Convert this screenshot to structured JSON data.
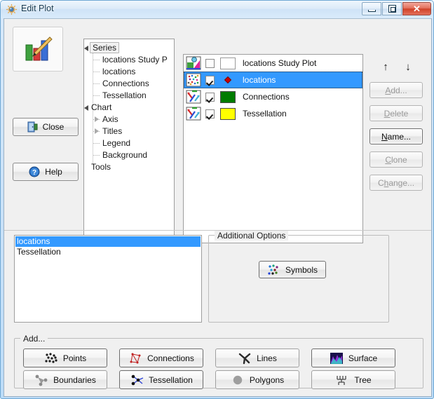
{
  "window": {
    "title": "Edit Plot",
    "icon": "sun-gear-icon",
    "controls": {
      "minimize": "minimize-button",
      "maximize": "maximize-button",
      "close": "close-button",
      "close_glyph": "✕"
    }
  },
  "left_panel": {
    "logo_icon": "bar-chart-pencil-icon",
    "buttons": [
      {
        "label": "Close",
        "icon": "door-exit-icon"
      },
      {
        "label": "Help",
        "icon": "question-mark-icon"
      }
    ]
  },
  "tree": {
    "nodes": [
      {
        "label": "Series",
        "level": 0,
        "expander": "open",
        "selected": true
      },
      {
        "label": "locations Study P",
        "level": 1,
        "expander": "none",
        "selected": false
      },
      {
        "label": "locations",
        "level": 1,
        "expander": "none",
        "selected": false
      },
      {
        "label": "Connections",
        "level": 1,
        "expander": "none",
        "selected": false
      },
      {
        "label": "Tessellation",
        "level": 1,
        "expander": "none",
        "selected": false
      },
      {
        "label": "Chart",
        "level": 0,
        "expander": "open",
        "selected": false
      },
      {
        "label": "Axis",
        "level": 1,
        "expander": "closed",
        "selected": false
      },
      {
        "label": "Titles",
        "level": 1,
        "expander": "closed",
        "selected": false
      },
      {
        "label": "Legend",
        "level": 1,
        "expander": "none",
        "selected": false
      },
      {
        "label": "Background",
        "level": 1,
        "expander": "none",
        "selected": false
      },
      {
        "label": "Tools",
        "level": 0,
        "expander": "none",
        "selected": false
      }
    ],
    "scrollbar": {
      "left_arrow": "◀",
      "right_arrow": "▶"
    }
  },
  "series_list": {
    "rows": [
      {
        "label": "locations Study Plot",
        "icon": "study-plot-icon",
        "checked": false,
        "swatch": "",
        "swatch_kind": "empty",
        "selected": false
      },
      {
        "label": "locations",
        "icon": "scatter-dots-icon",
        "checked": true,
        "swatch": "#cc0000",
        "swatch_kind": "marker",
        "selected": true
      },
      {
        "label": "Connections",
        "icon": "line-chart-icon",
        "checked": true,
        "swatch": "#007c00",
        "swatch_kind": "color",
        "selected": false
      },
      {
        "label": "Tessellation",
        "icon": "line-chart-icon",
        "checked": true,
        "swatch": "#ffff00",
        "swatch_kind": "color",
        "selected": false
      }
    ]
  },
  "right_buttons": {
    "move_up": "↑",
    "move_down": "↓",
    "items": [
      {
        "label": "Add...",
        "accel": "A",
        "enabled": false
      },
      {
        "label": "Delete",
        "accel": "D",
        "enabled": false
      },
      {
        "label": "Name...",
        "accel": "N",
        "enabled": true
      },
      {
        "label": "Clone",
        "accel": "C",
        "enabled": false
      },
      {
        "label": "Change...",
        "accel": "h",
        "enabled": false
      }
    ]
  },
  "bottom_list": {
    "rows": [
      {
        "label": "locations",
        "selected": true
      },
      {
        "label": "Tessellation",
        "selected": false
      }
    ]
  },
  "additional_options": {
    "title": "Additional Options",
    "symbols_button": {
      "label": "Symbols",
      "icon": "symbols-dots-icon"
    }
  },
  "add_group": {
    "title": "Add...",
    "buttons": [
      {
        "label": "Points",
        "icon": "points-icon",
        "row": 0,
        "col": 0,
        "strong": true
      },
      {
        "label": "Connections",
        "icon": "connections-icon",
        "row": 0,
        "col": 1,
        "strong": true
      },
      {
        "label": "Lines",
        "icon": "lines-icon",
        "row": 0,
        "col": 2,
        "strong": false
      },
      {
        "label": "Surface",
        "icon": "surface-icon",
        "row": 0,
        "col": 3,
        "strong": true
      },
      {
        "label": "Boundaries",
        "icon": "boundaries-icon",
        "row": 1,
        "col": 0,
        "strong": false
      },
      {
        "label": "Tessellation",
        "icon": "tessellation-icon",
        "row": 1,
        "col": 1,
        "strong": true
      },
      {
        "label": "Polygons",
        "icon": "polygons-icon",
        "row": 1,
        "col": 2,
        "strong": false
      },
      {
        "label": "Tree",
        "icon": "tree-icon",
        "row": 1,
        "col": 3,
        "strong": false
      }
    ]
  },
  "colors": {
    "selection": "#3399ff",
    "dialog_bg": "#f0f0f0",
    "frame": "#bcdcf8"
  }
}
